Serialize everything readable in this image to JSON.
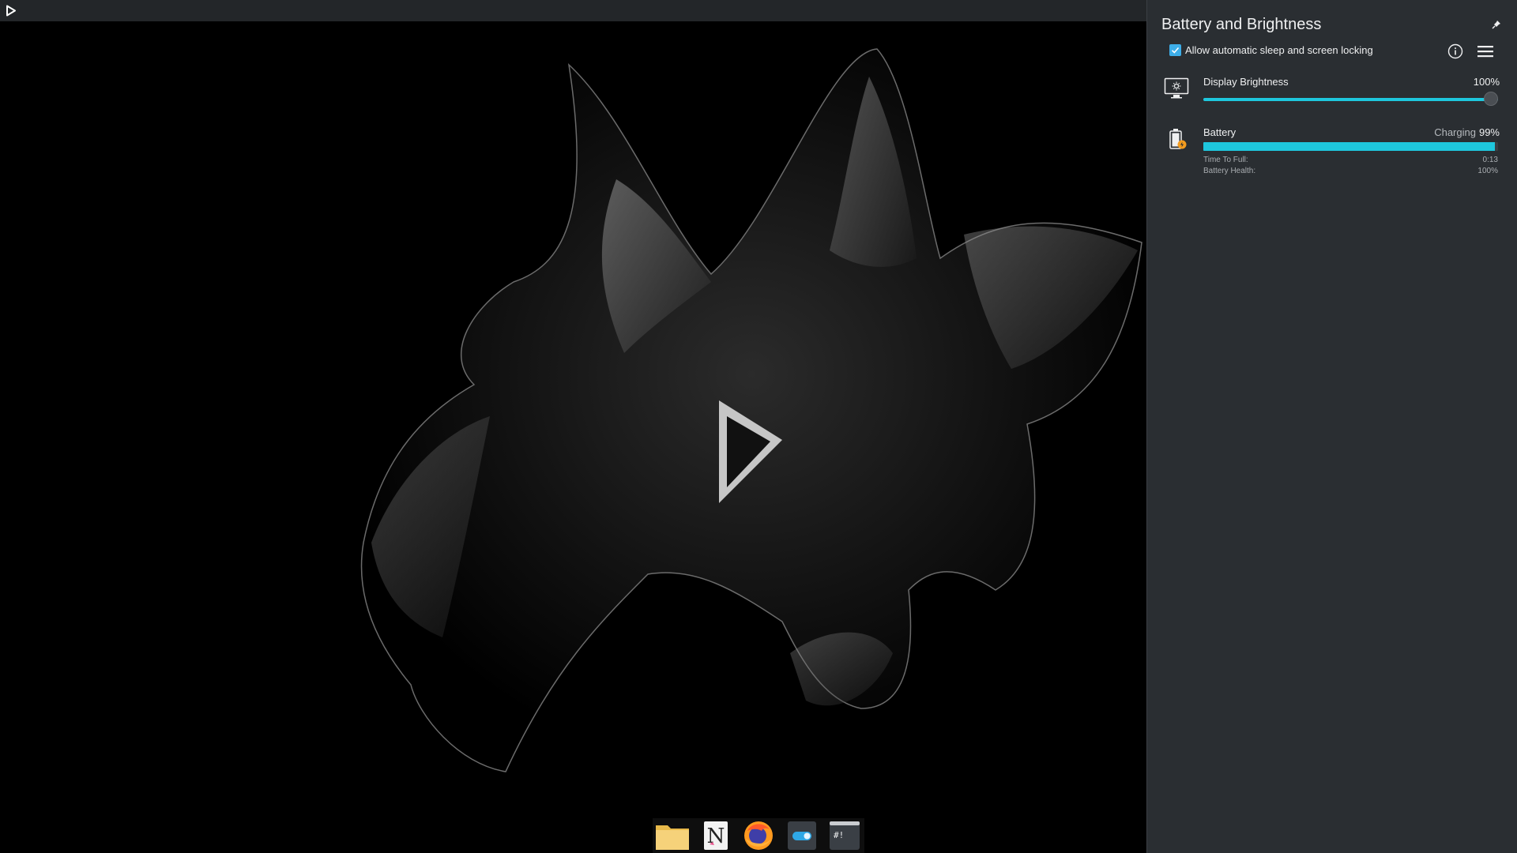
{
  "topbar": {
    "launcher_icon": "play-triangle-icon"
  },
  "dock": {
    "items": [
      {
        "icon": "folder-icon",
        "label": "Files",
        "color": "#f2c94c"
      },
      {
        "icon": "notes-icon",
        "label": "Notes",
        "color": "#e6e6e6"
      },
      {
        "icon": "firefox-icon",
        "label": "Firefox",
        "color": "#ff7a18"
      },
      {
        "icon": "toggle-settings-icon",
        "label": "Settings",
        "color": "#2fa8e6"
      },
      {
        "icon": "terminal-icon",
        "label": "Terminal",
        "glyph": "#!",
        "color": "#3a3f45"
      }
    ]
  },
  "panel": {
    "title": "Battery and Brightness",
    "pin_icon": "pin-icon",
    "sleep_checkbox": {
      "label": "Allow automatic sleep and screen locking",
      "checked": true
    },
    "info_icon": "info-icon",
    "menu_icon": "hamburger-menu-icon",
    "brightness": {
      "label": "Display Brightness",
      "value_text": "100%",
      "value": 100,
      "icon": "display-brightness-icon"
    },
    "battery": {
      "label": "Battery",
      "state": "Charging",
      "percent_text": "99%",
      "percent": 99,
      "icon": "battery-charging-icon",
      "details": [
        {
          "label": "Time To Full:",
          "value": "0:13"
        },
        {
          "label": "Battery Health:",
          "value": "100%"
        }
      ]
    }
  },
  "colors": {
    "accent": "#1ec7dd",
    "checkbox": "#3daee9",
    "panel_bg": "#2a2e32",
    "topbar_bg": "#232629"
  }
}
